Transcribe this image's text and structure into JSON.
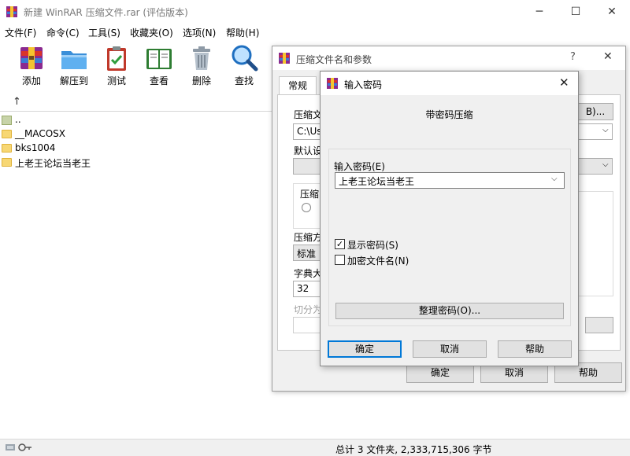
{
  "window": {
    "title": "新建 WinRAR 压缩文件.rar (评估版本)",
    "controls": {
      "minimize": "─",
      "maximize": "☐",
      "close": "✕"
    }
  },
  "menu": [
    "文件(F)",
    "命令(C)",
    "工具(S)",
    "收藏夹(O)",
    "选项(N)",
    "帮助(H)"
  ],
  "toolbar": [
    {
      "label": "添加",
      "icon": "add-archive-icon"
    },
    {
      "label": "解压到",
      "icon": "extract-folder-icon"
    },
    {
      "label": "测试",
      "icon": "test-clipboard-icon"
    },
    {
      "label": "查看",
      "icon": "view-book-icon"
    },
    {
      "label": "删除",
      "icon": "delete-trash-icon"
    },
    {
      "label": "查找",
      "icon": "find-magnifier-icon"
    }
  ],
  "nav": {
    "up_symbol": "↑"
  },
  "files": [
    {
      "name": "..",
      "kind": "parent"
    },
    {
      "name": "__MACOSX",
      "kind": "folder"
    },
    {
      "name": "bks1004",
      "kind": "folder"
    },
    {
      "name": "上老王论坛当老王",
      "kind": "folder"
    }
  ],
  "status": {
    "summary": "总计 3 文件夹, 2,333,715,306 字节"
  },
  "archive_dialog": {
    "title": "压缩文件名和参数",
    "help": "?",
    "close": "✕",
    "tab": "常规",
    "archive_name_label": "压缩文",
    "browse_suffix": "B)...",
    "path_value": "C:\\Use",
    "profile_label": "默认设",
    "format_group": "压缩",
    "method_label": "压缩方",
    "method_value": "标准",
    "dict_label": "字典大",
    "dict_value": "32",
    "split_label": "切分为",
    "ok": "确定",
    "cancel": "取消",
    "help_button": "帮助"
  },
  "password_dialog": {
    "title": "输入密码",
    "close": "✕",
    "heading": "带密码压缩",
    "field_label": "输入密码(E)",
    "field_value": "上老王论坛当老王",
    "show_password": {
      "label": "显示密码(S)",
      "checked": true,
      "mark": "✓"
    },
    "encrypt_names": {
      "label": "加密文件名(N)",
      "checked": false
    },
    "manage_button": "整理密码(O)...",
    "ok": "确定",
    "cancel": "取消",
    "help": "帮助"
  },
  "colors": {
    "accent": "#0078d7",
    "folder": "#f7d774",
    "dialog_bg": "#f0f0f0"
  }
}
